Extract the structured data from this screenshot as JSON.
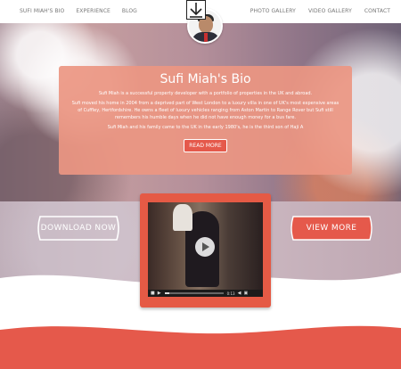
{
  "nav": {
    "left": [
      "SUFI MIAH'S BIO",
      "EXPERIENCE",
      "BLOG"
    ],
    "right": [
      "PHOTO GALLERY",
      "VIDEO GALLERY",
      "CONTACT"
    ]
  },
  "bio": {
    "title": "Sufi Miah's Bio",
    "paragraphs": [
      "Sufi Miah is a successful property developer with a portfolio of properties in the UK and abroad.",
      "Sufi moved his home in 2004 from a deprived part of West London to a luxury villa in one of UK's most expensive areas of Cuffley, Hertfordshire. He owns a fleet of luxury vehicles ranging from Aston Martin to Range Rover but Sufi still remembers his humble days when he did not have enough money for a bus fare.",
      "Sufi Miah and his family came to the UK in the early 1980's, he is the third son of Haji A"
    ],
    "read_more": "READ MORE"
  },
  "buttons": {
    "download_now": "DOWNLOAD NOW",
    "view_more": "VIEW MORE"
  },
  "video": {
    "time": "0:13",
    "progress": 0.08
  },
  "colors": {
    "accent": "#e5594b",
    "card": "#ec9682",
    "nav_text": "#777777"
  }
}
